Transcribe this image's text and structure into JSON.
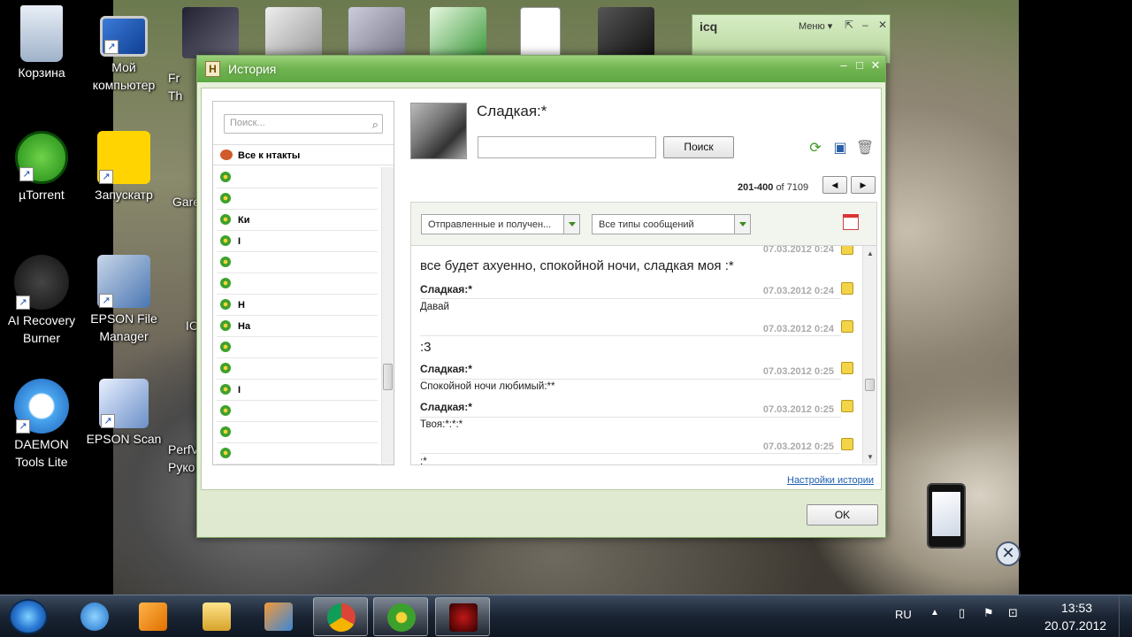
{
  "desktop": {
    "icons": [
      {
        "label": "Корзина",
        "name": "recycle-bin"
      },
      {
        "label": "Мой компьютер",
        "name": "my-computer"
      },
      {
        "label": "µTorrent",
        "name": "utorrent"
      },
      {
        "label": "Запускатр",
        "name": "zapuskatr"
      },
      {
        "label": "AI Recovery Burner",
        "name": "ai-recovery-burner"
      },
      {
        "label": "EPSON File Manager",
        "name": "epson-file-manager"
      },
      {
        "label": "DAEMON Tools Lite",
        "name": "daemon-tools-lite"
      },
      {
        "label": "EPSON Scan",
        "name": "epson-scan"
      }
    ],
    "partial_labels": [
      "Fr",
      "Th",
      "Gare",
      "IC",
      "PerfV",
      "Руко"
    ]
  },
  "icq_window": {
    "logo": "icq",
    "menu": "Меню ▾",
    "controls": [
      "⇱",
      "–",
      "✕"
    ]
  },
  "history_window": {
    "app_icon": "H",
    "title": "История",
    "search_placeholder": "Поиск...",
    "all_contacts": "Все к нтакты",
    "contacts": [
      "",
      "",
      "Ки",
      "I",
      "",
      "",
      "Н",
      "На",
      "",
      "",
      "I",
      "",
      "",
      "",
      ""
    ],
    "contact_name": "Сладкая:*",
    "search_button": "Поиск",
    "pager": {
      "range": "201-400",
      "of": "of 7109"
    },
    "filter_direction": "Отправленные и получен...",
    "filter_type": "Все типы сообщений",
    "messages": [
      {
        "date": "07.03.2012 0:24"
      },
      {
        "body": "все будет ахуенно, спокойной ночи, сладкая моя :*"
      },
      {
        "sender": "Сладкая:*",
        "date": "07.03.2012 0:24",
        "body": "Давай"
      },
      {
        "date": "07.03.2012 0:24"
      },
      {
        "body": ":3"
      },
      {
        "sender": "Сладкая:*",
        "date": "07.03.2012 0:25",
        "body": "Спокойной ночи любимый:**"
      },
      {
        "sender": "Сладкая:*",
        "date": "07.03.2012 0:25",
        "body": "Твоя:*:*:*"
      },
      {
        "date": "07.03.2012 0:25"
      },
      {
        "body": ":*"
      }
    ],
    "settings_link": "Настройки истории",
    "ok_button": "OK"
  },
  "taskbar": {
    "items": [
      "ie",
      "media-player",
      "explorer",
      "paint",
      "chrome",
      "icq",
      "game"
    ],
    "lang": "RU",
    "time": "13:53",
    "date": "20.07.2012"
  }
}
